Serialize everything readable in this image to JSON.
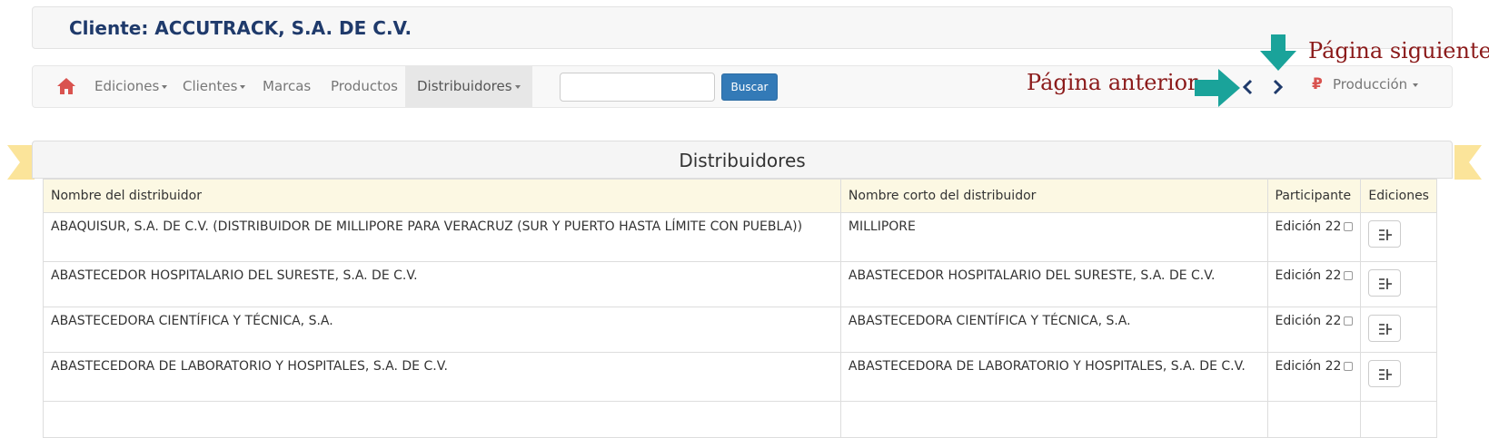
{
  "client": {
    "label": "Cliente:",
    "name": "ACCUTRACK, S.A. DE C.V."
  },
  "nav": {
    "items": [
      {
        "label": "Ediciones",
        "dropdown": true
      },
      {
        "label": "Clientes",
        "dropdown": true
      },
      {
        "label": "Marcas",
        "dropdown": false
      },
      {
        "label": "Productos",
        "dropdown": false
      },
      {
        "label": "Distribuidores",
        "dropdown": true,
        "active": true
      }
    ],
    "search": {
      "value": "",
      "placeholder": "",
      "button": "Buscar"
    },
    "pager": {
      "prev_icon": "chevron-left-icon",
      "next_icon": "chevron-right-icon"
    },
    "environment": {
      "label": "Producción",
      "icon": "ruble-icon"
    }
  },
  "annotations": {
    "prev_page": "Página anterior",
    "next_page": "Página siguiente",
    "arrow_color": "#1aa39a"
  },
  "panel": {
    "title": "Distribuidores"
  },
  "table": {
    "headers": [
      "Nombre del distribuidor",
      "Nombre corto del distribuidor",
      "Participante",
      "Ediciones"
    ],
    "rows": [
      {
        "name": "ABAQUISUR, S.A. DE C.V. (DISTRIBUIDOR DE MILLIPORE PARA VERACRUZ (SUR Y PUERTO HASTA LÍMITE CON PUEBLA))",
        "short": "MILLIPORE",
        "participant": "Edición 22"
      },
      {
        "name": "ABASTECEDOR HOSPITALARIO DEL SURESTE, S.A. DE C.V.",
        "short": "ABASTECEDOR HOSPITALARIO DEL SURESTE, S.A. DE C.V.",
        "participant": "Edición 22"
      },
      {
        "name": "ABASTECEDORA CIENTÍFICA Y TÉCNICA, S.A.",
        "short": "ABASTECEDORA CIENTÍFICA Y TÉCNICA, S.A.",
        "participant": "Edición 22"
      },
      {
        "name": "ABASTECEDORA DE LABORATORIO Y HOSPITALES, S.A. DE C.V.",
        "short": "ABASTECEDORA DE LABORATORIO Y HOSPITALES, S.A. DE C.V.",
        "participant": "Edición 22"
      },
      {
        "name": "",
        "short": "",
        "participant": ""
      }
    ]
  },
  "colors": {
    "client_title": "#1f3a6b",
    "brand_button": "#337ab7",
    "annotation_text": "#8b1a1a",
    "ribbon": "#fbe49a",
    "header_bg": "#fcf8e3"
  }
}
